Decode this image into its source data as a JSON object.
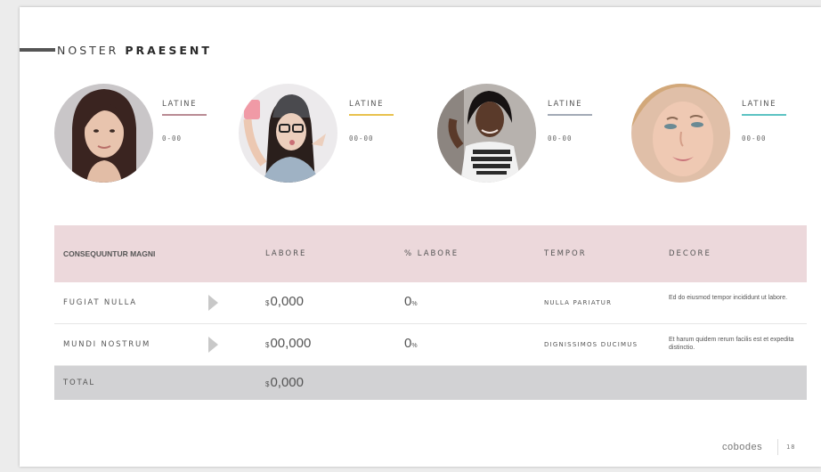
{
  "header": {
    "title_light": "NOSTER",
    "title_bold": "PRAESENT"
  },
  "people": [
    {
      "label": "LATINE",
      "value": "0-00",
      "accent": "#b98b94",
      "avatar_desc": "portrait-1"
    },
    {
      "label": "LATINE",
      "value": "00-00",
      "accent": "#e8c14e",
      "avatar_desc": "portrait-2"
    },
    {
      "label": "LATINE",
      "value": "00-00",
      "accent": "#a2aab6",
      "avatar_desc": "portrait-3"
    },
    {
      "label": "LATINE",
      "value": "00-00",
      "accent": "#5cc3c3",
      "avatar_desc": "portrait-4"
    }
  ],
  "table": {
    "header_bg": "#ecd8db",
    "columns": [
      "CONSEQUUNTUR MAGNI",
      "LABORE",
      "% LABORE",
      "TEMPOR",
      "DECORE"
    ],
    "rows": [
      {
        "name": "FUGIAT NULLA",
        "currency": "$",
        "amount": "0,000",
        "percent": "0",
        "percent_symbol": "%",
        "tempor": "NULLA PARIATUR",
        "decore": "Ed do eiusmod tempor incididunt ut labore."
      },
      {
        "name": "MUNDI NOSTRUM",
        "currency": "$",
        "amount": "00,000",
        "percent": "0",
        "percent_symbol": "%",
        "tempor": "DIGNISSIMOS DUCIMUS",
        "decore": "Et harum quidem rerum facilis est et expedita distinctio."
      }
    ],
    "total": {
      "label": "TOTAL",
      "currency": "$",
      "amount": "0,000"
    }
  },
  "footer": {
    "brand": "cobodes",
    "page": "18"
  }
}
